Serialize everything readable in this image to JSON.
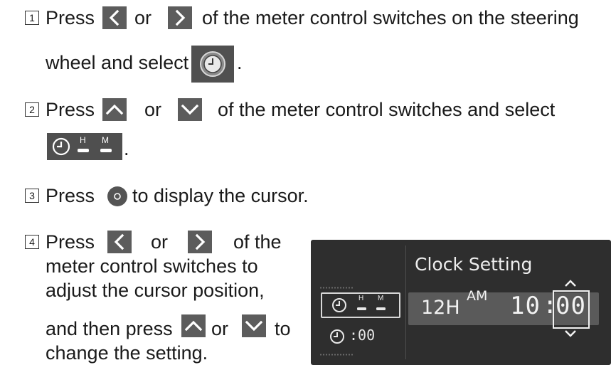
{
  "steps": [
    {
      "num": "1",
      "line1_a": "Press",
      "line1_or": "or",
      "line1_b": "of the meter control switches on the steering",
      "line2": "wheel and select",
      "line2_end": "."
    },
    {
      "num": "2",
      "line1_a": "Press",
      "line1_or": "or",
      "line1_b": "of the meter control switches and select",
      "line2_end": "."
    },
    {
      "num": "3",
      "line1_a": "Press",
      "line1_b": "to display the cursor."
    },
    {
      "num": "4",
      "line1_a": "Press",
      "line1_or": "or",
      "line1_b": "of the",
      "line2": "meter control switches to",
      "line3": "adjust the cursor position,",
      "line4_a": "and then press",
      "line4_or": "or",
      "line4_b": "to",
      "line5": "change the setting."
    }
  ],
  "icons": {
    "left": "chevron-left-icon",
    "right": "chevron-right-icon",
    "up": "chevron-up-icon",
    "down": "chevron-down-icon",
    "enter": "enter-button-icon",
    "settings": "clock-settings-icon",
    "clock_hm": "clock-hour-minute-icon"
  },
  "clock_hm_icon": {
    "h": "H",
    "m": "M"
  },
  "display": {
    "title": "Clock Setting",
    "format": "12H",
    "period": "AM",
    "hours": "10",
    "separator": ":",
    "minutes": "00",
    "menu_item_2": ":00"
  },
  "colors": {
    "key_bg": "#5c5c5c",
    "panel_bg": "#2e2e2e",
    "row_bg": "#5a5a5a"
  }
}
